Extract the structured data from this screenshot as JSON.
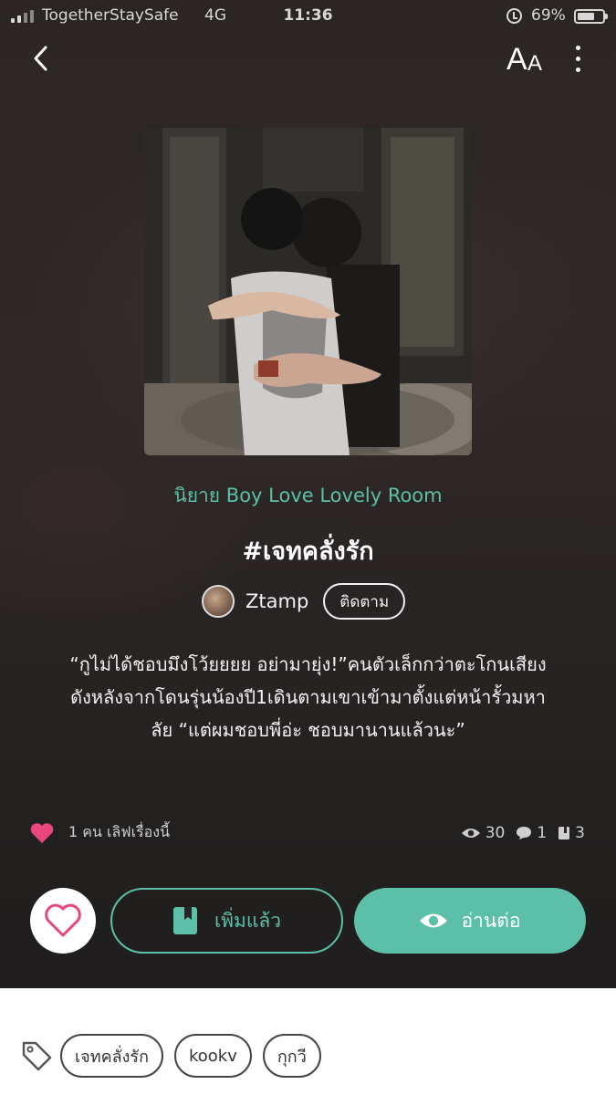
{
  "status_bar": {
    "carrier": "TogetherStaySafe",
    "network": "4G",
    "time": "11:36",
    "battery": "69%",
    "battery_level": 0.69
  },
  "nav": {
    "back_icon": "chevron-left-icon",
    "font_size_label_big": "A",
    "font_size_label_small": "A",
    "more_icon": "more-vertical-icon"
  },
  "novel": {
    "category": "นิยาย Boy Love Lovely Room",
    "title": "#เจทคลั่งรัก",
    "author": "Ztamp",
    "follow_label": "ติดตาม",
    "synopsis_lines": [
      "“กูไม่ได้ชอบมึงโว้ยยยย อย่ามายุ่ง!”คนตัวเล็กกว่าตะโกนเสียง",
      "ดังหลังจากโดนรุ่นน้องปี1เดินตามเขาเข้ามาตั้งแต่หน้ารั้วมหา",
      "ลัย “แต่ผมชอบพี่อ่ะ ชอบมานานแล้วนะ”"
    ],
    "love_text": "1 คน เลิฟเรื่องนี้",
    "views": "30",
    "comments": "1",
    "chapters": "3"
  },
  "actions": {
    "added_label": "เพิ่มแล้ว",
    "read_label": "อ่านต่อ"
  },
  "tags": [
    "เจทคลั่งรัก",
    "kookv",
    "กุกวี"
  ],
  "colors": {
    "accent": "#5cbfa7",
    "heart": "#e8467c",
    "background": "#2b2523"
  }
}
